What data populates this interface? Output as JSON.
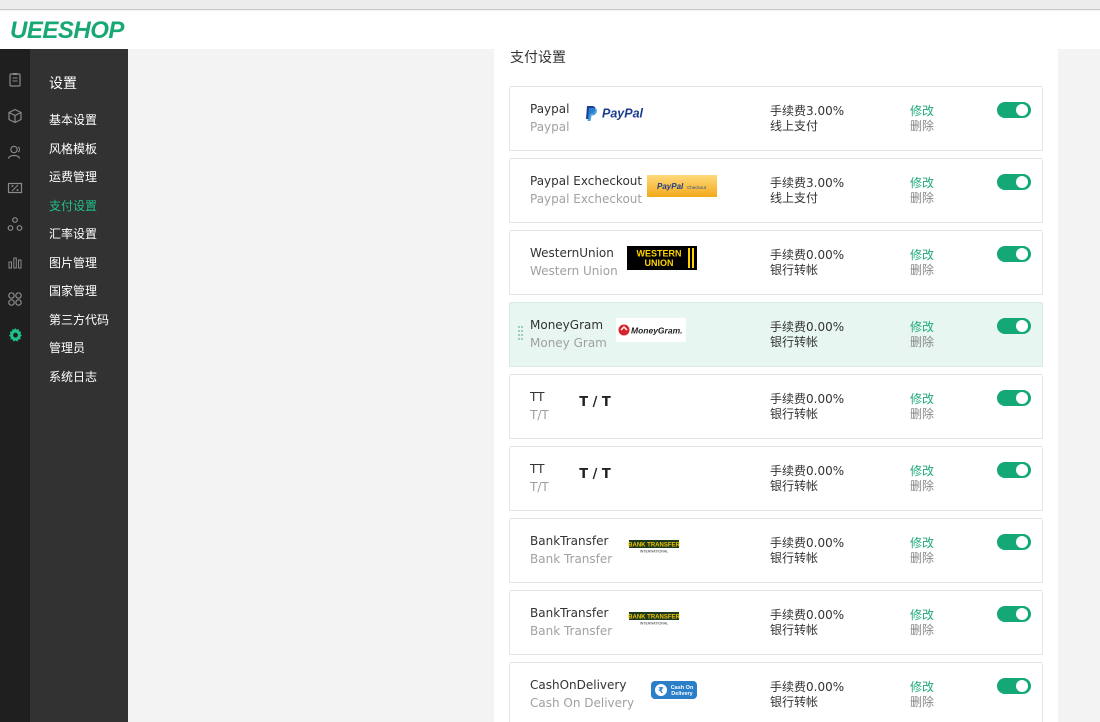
{
  "brand": {
    "logo_text": "UEESHOP"
  },
  "iconbar": [
    {
      "name": "orders-icon"
    },
    {
      "name": "products-icon"
    },
    {
      "name": "users-icon"
    },
    {
      "name": "promotion-icon"
    },
    {
      "name": "channel-icon"
    },
    {
      "name": "stats-icon"
    },
    {
      "name": "apps-icon"
    },
    {
      "name": "settings-icon"
    }
  ],
  "sidebar": {
    "title": "设置",
    "items": [
      {
        "label": "基本设置"
      },
      {
        "label": "风格模板"
      },
      {
        "label": "运费管理"
      },
      {
        "label": "支付设置",
        "active": true
      },
      {
        "label": "汇率设置"
      },
      {
        "label": "图片管理"
      },
      {
        "label": "国家管理"
      },
      {
        "label": "第三方代码"
      },
      {
        "label": "管理员"
      },
      {
        "label": "系统日志"
      }
    ]
  },
  "panel": {
    "title": "支付设置"
  },
  "actions": {
    "edit": "修改",
    "delete": "删除"
  },
  "payments": [
    {
      "name": "Paypal",
      "sub": "Paypal",
      "fee": "手续费3.00%",
      "type": "线上支付",
      "logo": "paypal",
      "logo_text": "PayPal",
      "enabled": true
    },
    {
      "name": "Paypal Excheckout",
      "sub": "Paypal Excheckout",
      "fee": "手续费3.00%",
      "type": "线上支付",
      "logo": "paypal-checkout",
      "logo_text": "PayPal",
      "logo_text2": "Checkout",
      "enabled": true
    },
    {
      "name": "WesternUnion",
      "sub": "Western Union",
      "fee": "手续费0.00%",
      "type": "银行转帐",
      "logo": "western-union",
      "logo_text": "WESTERN",
      "logo_text2": "UNION",
      "enabled": true
    },
    {
      "name": "MoneyGram",
      "sub": "Money Gram",
      "fee": "手续费0.00%",
      "type": "银行转帐",
      "logo": "moneygram",
      "logo_text": "MoneyGram.",
      "enabled": true,
      "highlighted": true
    },
    {
      "name": "TT",
      "sub": "T/T",
      "fee": "手续费0.00%",
      "type": "银行转帐",
      "logo": "tt",
      "logo_text": "T / T",
      "enabled": true
    },
    {
      "name": "TT",
      "sub": "T/T",
      "fee": "手续费0.00%",
      "type": "银行转帐",
      "logo": "tt",
      "logo_text": "T / T",
      "enabled": true
    },
    {
      "name": "BankTransfer",
      "sub": "Bank Transfer",
      "fee": "手续费0.00%",
      "type": "银行转帐",
      "logo": "bank-transfer",
      "logo_text": "BANK TRANSFER",
      "logo_text2": "INTERNATIONAL",
      "enabled": true
    },
    {
      "name": "BankTransfer",
      "sub": "Bank Transfer",
      "fee": "手续费0.00%",
      "type": "银行转帐",
      "logo": "bank-transfer",
      "logo_text": "BANK TRANSFER",
      "logo_text2": "INTERNATIONAL",
      "enabled": true
    },
    {
      "name": "CashOnDelivery",
      "sub": "Cash On Delivery",
      "fee": "手续费0.00%",
      "type": "银行转帐",
      "logo": "cash-on-delivery",
      "logo_text": "Cash On",
      "logo_text2": "Delivery",
      "enabled": true
    }
  ],
  "colors": {
    "accent": "#13a876",
    "sidebar": "#323232",
    "iconbar": "#1f1f1f"
  }
}
